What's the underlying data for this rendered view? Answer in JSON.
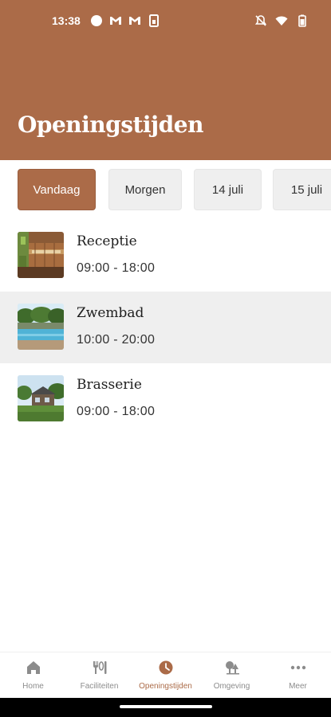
{
  "status_bar": {
    "time": "13:38",
    "left_icons": [
      "circle-notification-icon",
      "gmail-icon",
      "gmail-icon",
      "sim-icon"
    ],
    "right_icons": [
      "bell-off-icon",
      "wifi-icon",
      "battery-icon"
    ]
  },
  "header": {
    "title": "Openingstijden",
    "color": "#ab6b48"
  },
  "day_tabs": [
    {
      "label": "Vandaag",
      "active": true
    },
    {
      "label": "Morgen",
      "active": false
    },
    {
      "label": "14 juli",
      "active": false
    },
    {
      "label": "15 juli",
      "active": false
    }
  ],
  "facilities": [
    {
      "name": "Receptie",
      "hours": "09:00 - 18:00",
      "thumb": "reception-photo"
    },
    {
      "name": "Zwembad",
      "hours": "10:00 - 20:00",
      "thumb": "pool-photo"
    },
    {
      "name": "Brasserie",
      "hours": "09:00 - 18:00",
      "thumb": "brasserie-photo"
    }
  ],
  "bottom_nav": [
    {
      "label": "Home",
      "icon": "home-icon",
      "active": false
    },
    {
      "label": "Faciliteiten",
      "icon": "cutlery-icon",
      "active": false
    },
    {
      "label": "Openingstijden",
      "icon": "clock-icon",
      "active": true
    },
    {
      "label": "Omgeving",
      "icon": "trees-icon",
      "active": false
    },
    {
      "label": "Meer",
      "icon": "more-icon",
      "active": false
    }
  ],
  "colors": {
    "accent": "#ab6b48",
    "inactive_nav": "#8c8c8c",
    "alt_row": "#efefef"
  }
}
